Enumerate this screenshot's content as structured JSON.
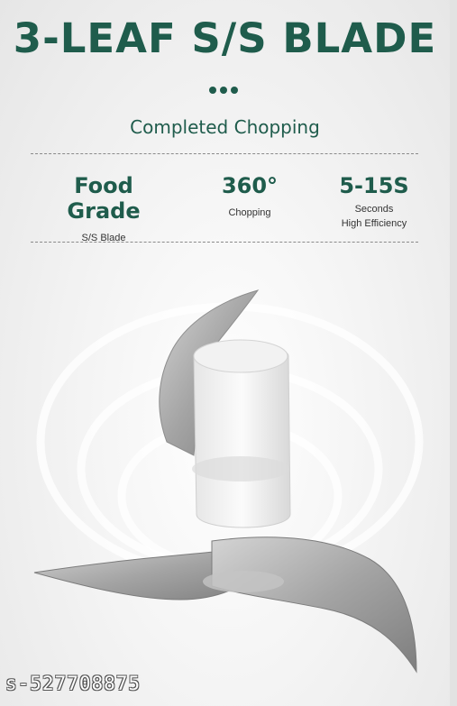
{
  "header": {
    "title": "3-LEAF S/S BLADE",
    "subtitle": "Completed Chopping"
  },
  "features": [
    {
      "head": "Food Grade",
      "sub": "S/S Blade"
    },
    {
      "head": "360°",
      "sub": "Chopping"
    },
    {
      "head": "5-15S",
      "sub": "Seconds",
      "sub2": "High Efficiency"
    }
  ],
  "watermark": "s-527708875",
  "colors": {
    "accent": "#1f5c4c",
    "blade": "#a9a9a9"
  },
  "icons": [
    "blade-image"
  ]
}
